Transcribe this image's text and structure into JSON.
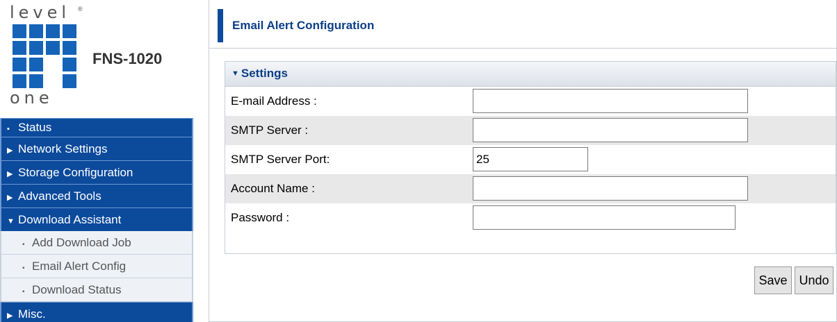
{
  "brand": {
    "logo_top": "level",
    "logo_reg": "®",
    "logo_bottom": "one",
    "model": "FNS-1020"
  },
  "sidebar": {
    "items": [
      {
        "label": "Status",
        "marker": "▪",
        "expanded": false
      },
      {
        "label": "Network Settings",
        "marker": "▶",
        "expanded": false
      },
      {
        "label": "Storage Configuration",
        "marker": "▶",
        "expanded": false
      },
      {
        "label": "Advanced Tools",
        "marker": "▶",
        "expanded": false
      },
      {
        "label": "Download Assistant",
        "marker": "▼",
        "expanded": true
      },
      {
        "label": "Misc.",
        "marker": "▶",
        "expanded": false
      }
    ],
    "sub_items": [
      {
        "label": "Add Download Job",
        "marker": "▪"
      },
      {
        "label": "Email Alert Config",
        "marker": "▪"
      },
      {
        "label": "Download Status",
        "marker": "▪"
      }
    ]
  },
  "header": {
    "title": "Email Alert Configuration"
  },
  "settings": {
    "section_title": "Settings",
    "section_marker": "▼",
    "fields": [
      {
        "label": "E-mail Address :",
        "value": ""
      },
      {
        "label": "SMTP Server :",
        "value": ""
      },
      {
        "label": "SMTP Server Port:",
        "value": "25"
      },
      {
        "label": "Account Name :",
        "value": ""
      },
      {
        "label": "Password :",
        "value": ""
      }
    ]
  },
  "actions": {
    "save_label": "Save",
    "undo_label": "Undo"
  },
  "colors": {
    "nav_bg": "#0c4a9c",
    "sub_bg": "#eef1f6",
    "title_text": "#0c3f86",
    "logo_blue": "#1463b8"
  }
}
